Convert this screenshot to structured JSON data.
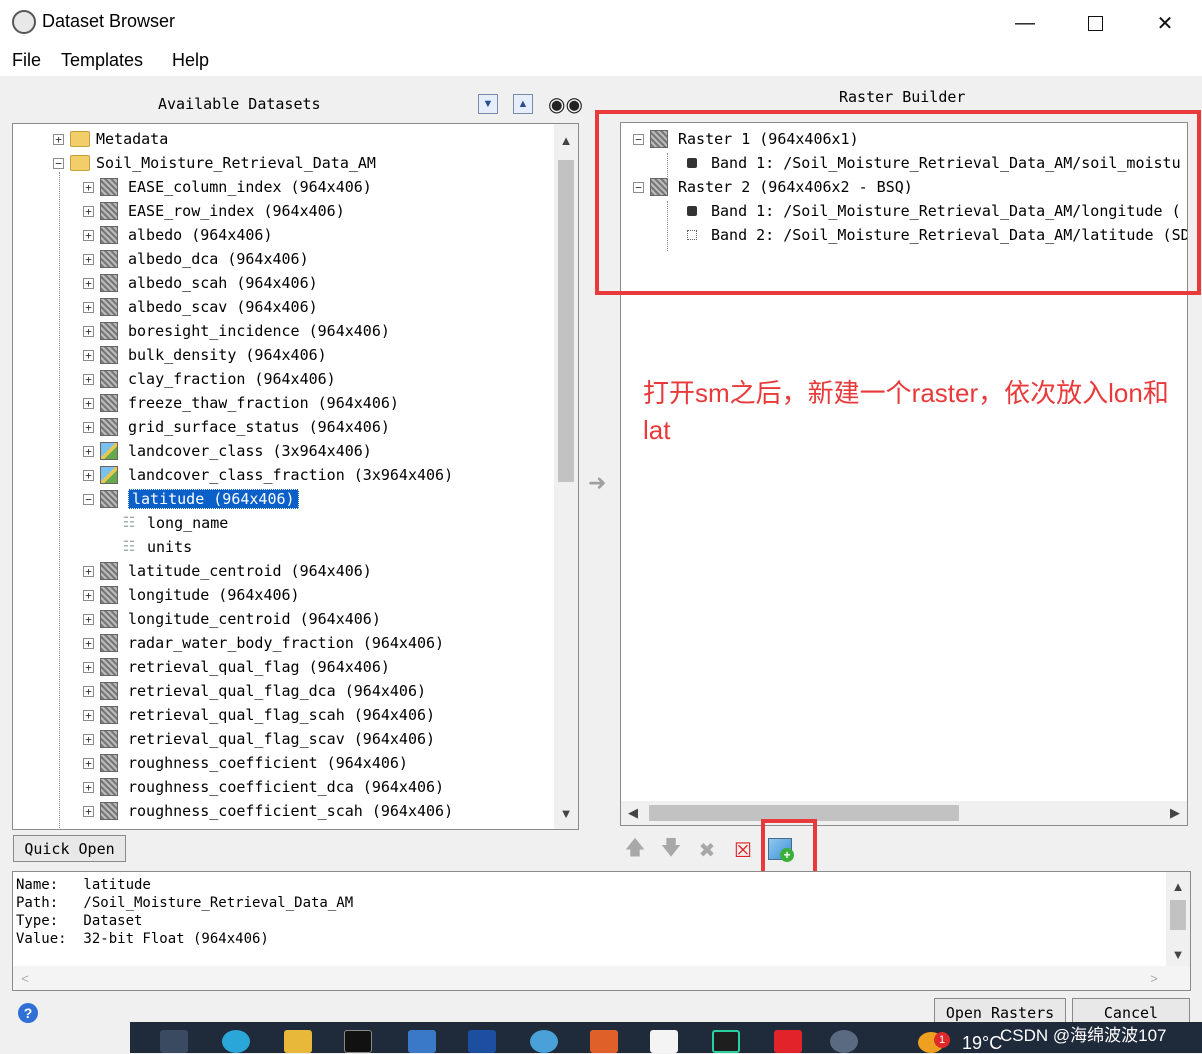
{
  "window": {
    "title": "Dataset Browser"
  },
  "menu": [
    "File",
    "Templates",
    "Help"
  ],
  "left_panel": {
    "title": "Available Datasets",
    "tree": [
      {
        "label": "Metadata",
        "type": "folder",
        "level": 0,
        "expanded": false
      },
      {
        "label": "Soil_Moisture_Retrieval_Data_AM",
        "type": "folder",
        "level": 0,
        "expanded": true
      },
      {
        "label": "EASE_column_index (964x406)",
        "type": "dataset",
        "level": 1
      },
      {
        "label": "EASE_row_index (964x406)",
        "type": "dataset",
        "level": 1
      },
      {
        "label": "albedo (964x406)",
        "type": "dataset",
        "level": 1
      },
      {
        "label": "albedo_dca (964x406)",
        "type": "dataset",
        "level": 1
      },
      {
        "label": "albedo_scah (964x406)",
        "type": "dataset",
        "level": 1
      },
      {
        "label": "albedo_scav (964x406)",
        "type": "dataset",
        "level": 1
      },
      {
        "label": "boresight_incidence (964x406)",
        "type": "dataset",
        "level": 1
      },
      {
        "label": "bulk_density (964x406)",
        "type": "dataset",
        "level": 1
      },
      {
        "label": "clay_fraction (964x406)",
        "type": "dataset",
        "level": 1
      },
      {
        "label": "freeze_thaw_fraction (964x406)",
        "type": "dataset",
        "level": 1
      },
      {
        "label": "grid_surface_status (964x406)",
        "type": "dataset",
        "level": 1
      },
      {
        "label": "landcover_class (3x964x406)",
        "type": "color",
        "level": 1
      },
      {
        "label": "landcover_class_fraction (3x964x406)",
        "type": "color",
        "level": 1
      },
      {
        "label": "latitude (964x406)",
        "type": "dataset",
        "level": 1,
        "selected": true,
        "expanded": true
      },
      {
        "label": "long_name",
        "type": "attr",
        "level": 2
      },
      {
        "label": "units",
        "type": "attr",
        "level": 2
      },
      {
        "label": "latitude_centroid (964x406)",
        "type": "dataset",
        "level": 1
      },
      {
        "label": "longitude (964x406)",
        "type": "dataset",
        "level": 1
      },
      {
        "label": "longitude_centroid (964x406)",
        "type": "dataset",
        "level": 1
      },
      {
        "label": "radar_water_body_fraction (964x406)",
        "type": "dataset",
        "level": 1
      },
      {
        "label": "retrieval_qual_flag (964x406)",
        "type": "dataset",
        "level": 1
      },
      {
        "label": "retrieval_qual_flag_dca (964x406)",
        "type": "dataset",
        "level": 1
      },
      {
        "label": "retrieval_qual_flag_scah (964x406)",
        "type": "dataset",
        "level": 1
      },
      {
        "label": "retrieval_qual_flag_scav (964x406)",
        "type": "dataset",
        "level": 1
      },
      {
        "label": "roughness_coefficient (964x406)",
        "type": "dataset",
        "level": 1
      },
      {
        "label": "roughness_coefficient_dca (964x406)",
        "type": "dataset",
        "level": 1
      },
      {
        "label": "roughness_coefficient_scah (964x406)",
        "type": "dataset",
        "level": 1
      }
    ],
    "quick_open_label": "Quick Open"
  },
  "right_panel": {
    "title": "Raster Builder",
    "tree": [
      {
        "label": "Raster 1 (964x406x1)",
        "type": "raster",
        "level": 0
      },
      {
        "label": "Band 1: /Soil_Moisture_Retrieval_Data_AM/soil_moistu",
        "type": "band",
        "level": 1,
        "filled": true
      },
      {
        "label": "Raster 2 (964x406x2 - BSQ)",
        "type": "raster",
        "level": 0
      },
      {
        "label": "Band 1: /Soil_Moisture_Retrieval_Data_AM/longitude (",
        "type": "band",
        "level": 1,
        "filled": true
      },
      {
        "label": "Band 2: /Soil_Moisture_Retrieval_Data_AM/latitude (SD",
        "type": "band",
        "level": 1,
        "filled": false
      }
    ],
    "annotation": "打开sm之后，新建一个raster，依次放入lon和lat"
  },
  "info": {
    "lines": [
      "Name:   latitude",
      "Path:   /Soil_Moisture_Retrieval_Data_AM",
      "Type:   Dataset",
      "Value:  32-bit Float (964x406)"
    ]
  },
  "buttons": {
    "open_rasters": "Open Rasters",
    "cancel": "Cancel"
  },
  "taskbar": {
    "temperature": "19°C",
    "watermark": "CSDN @海绵波波107",
    "notification_count": "1"
  },
  "colors": {
    "annotation_red": "#e83a3a",
    "selection_blue": "#0a60c8"
  }
}
